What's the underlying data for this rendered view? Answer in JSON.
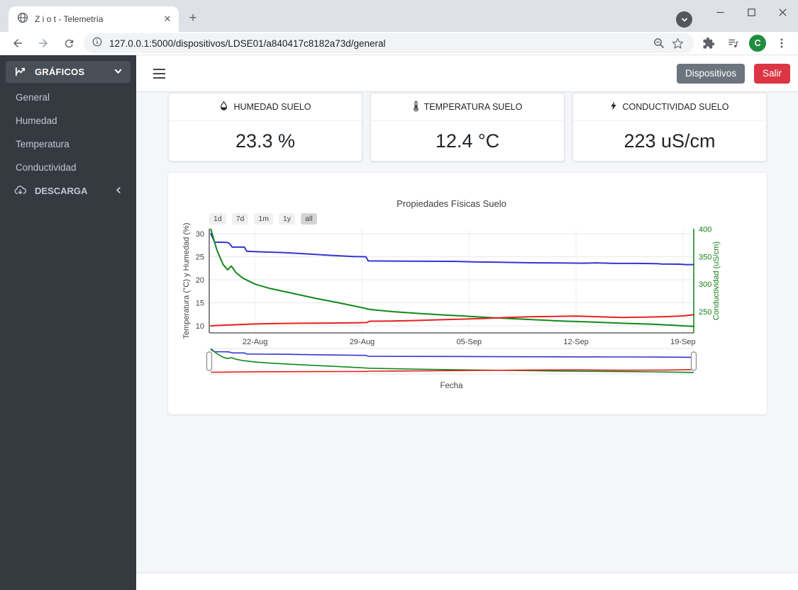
{
  "browser": {
    "tab_title": "Z i o t - Telemetría",
    "new_tab": "+",
    "url": "127.0.0.1:5000/dispositivos/LDSE01/a840417c8182a73d/general",
    "avatar_letter": "C",
    "avatar_color": "#1e8e3e"
  },
  "sidebar": {
    "items": [
      {
        "label": "GRÁFICOS",
        "icon": "chart-line-icon",
        "state": "expanded",
        "active": true
      },
      {
        "label": "General"
      },
      {
        "label": "Humedad"
      },
      {
        "label": "Temperatura"
      },
      {
        "label": "Conductividad"
      },
      {
        "label": "DESCARGA",
        "icon": "cloud-download-icon",
        "state": "collapsed"
      }
    ]
  },
  "navbar": {
    "buttons": [
      {
        "label": "Dispositivos",
        "color": "#6c757d"
      },
      {
        "label": "Salir",
        "color": "#dc3545"
      }
    ]
  },
  "cards": [
    {
      "title": "HUMEDAD SUELO",
      "icon": "droplet-icon",
      "value": "23.3 %"
    },
    {
      "title": "TEMPERATURA SUELO",
      "icon": "thermometer-icon",
      "value": "12.4 °C"
    },
    {
      "title": "CONDUCTIVIDAD SUELO",
      "icon": "bolt-icon",
      "value": "223 uS/cm"
    }
  ],
  "chart_data": {
    "type": "line",
    "title": "Propiedades Físicas Suelo",
    "xlabel": "Fecha",
    "range_selector": {
      "options": [
        "1d",
        "7d",
        "1m",
        "1y",
        "all"
      ],
      "active": "all"
    },
    "x_axis": {
      "range": [
        0,
        31.7
      ],
      "ticks": [
        {
          "pos": 3,
          "label": "22-Aug"
        },
        {
          "pos": 10,
          "label": "29-Aug"
        },
        {
          "pos": 17,
          "label": "05-Sep"
        },
        {
          "pos": 24,
          "label": "12-Sep"
        },
        {
          "pos": 31,
          "label": "19-Sep"
        }
      ]
    },
    "y_left": {
      "label": "Temperatura (°C) y Humedad (%)",
      "range": [
        8.46,
        31.08
      ],
      "ticks": [
        10,
        15,
        20,
        25,
        30
      ],
      "color": "#444444"
    },
    "y_right": {
      "label": "Conductividad (uS/cm)",
      "range": [
        211.3,
        400.8
      ],
      "ticks": [
        250,
        300,
        350,
        400
      ],
      "color": "#157f17"
    },
    "grid": true,
    "legend": "none",
    "series": [
      {
        "name": "Humedad (%)",
        "axis": "left",
        "color": "#3434d3",
        "points": [
          [
            0.1,
            30
          ],
          [
            0.35,
            28.2
          ],
          [
            1.2,
            28.1
          ],
          [
            1.35,
            27.8
          ],
          [
            1.5,
            27.1
          ],
          [
            2.3,
            27.1
          ],
          [
            2.45,
            26.2
          ],
          [
            3.6,
            26.05
          ],
          [
            5,
            25.9
          ],
          [
            6.5,
            25.6
          ],
          [
            8,
            25.3
          ],
          [
            9.5,
            25.05
          ],
          [
            10.25,
            25.0
          ],
          [
            10.4,
            24.1
          ],
          [
            13,
            24.05
          ],
          [
            16,
            24.0
          ],
          [
            17.3,
            23.9
          ],
          [
            19,
            23.8
          ],
          [
            21,
            23.7
          ],
          [
            23,
            23.65
          ],
          [
            24.5,
            23.6
          ],
          [
            25.3,
            23.68
          ],
          [
            26.5,
            23.55
          ],
          [
            28,
            23.55
          ],
          [
            29.3,
            23.5
          ],
          [
            29.6,
            23.42
          ],
          [
            30.8,
            23.38
          ],
          [
            31.2,
            23.3
          ],
          [
            31.7,
            23.3
          ]
        ]
      },
      {
        "name": "Conductividad (uS/cm)",
        "axis": "right",
        "color": "#12881b",
        "points": [
          [
            0.1,
            400
          ],
          [
            0.5,
            362
          ],
          [
            0.9,
            336
          ],
          [
            1.2,
            326
          ],
          [
            1.45,
            333
          ],
          [
            1.75,
            321
          ],
          [
            2.2,
            311
          ],
          [
            3,
            300
          ],
          [
            4,
            292
          ],
          [
            5.5,
            283
          ],
          [
            7,
            274
          ],
          [
            8.5,
            266
          ],
          [
            9.7,
            259
          ],
          [
            10.5,
            254
          ],
          [
            12,
            250
          ],
          [
            13.5,
            247
          ],
          [
            15,
            244.5
          ],
          [
            17,
            241.5
          ],
          [
            18.5,
            239
          ],
          [
            20,
            237
          ],
          [
            21.5,
            235
          ],
          [
            23,
            233
          ],
          [
            24.5,
            231.5
          ],
          [
            26,
            230
          ],
          [
            27.5,
            228.5
          ],
          [
            29,
            227
          ],
          [
            30.5,
            225
          ],
          [
            31.7,
            223
          ]
        ]
      },
      {
        "name": "Temperatura (°C)",
        "axis": "left",
        "color": "#e82020",
        "points": [
          [
            0.1,
            10.0
          ],
          [
            0.8,
            10.1
          ],
          [
            1.8,
            10.25
          ],
          [
            3,
            10.4
          ],
          [
            4.5,
            10.5
          ],
          [
            6,
            10.55
          ],
          [
            8,
            10.6
          ],
          [
            9.5,
            10.65
          ],
          [
            10.3,
            10.7
          ],
          [
            10.5,
            11.0
          ],
          [
            12,
            11.05
          ],
          [
            13.5,
            11.15
          ],
          [
            15,
            11.3
          ],
          [
            16.5,
            11.45
          ],
          [
            18,
            11.6
          ],
          [
            19.5,
            11.8
          ],
          [
            21,
            11.95
          ],
          [
            22.5,
            12.05
          ],
          [
            24,
            12.1
          ],
          [
            25.5,
            11.95
          ],
          [
            27,
            11.82
          ],
          [
            28.5,
            11.88
          ],
          [
            30,
            12.0
          ],
          [
            31,
            12.15
          ],
          [
            31.7,
            12.4
          ]
        ]
      }
    ]
  }
}
